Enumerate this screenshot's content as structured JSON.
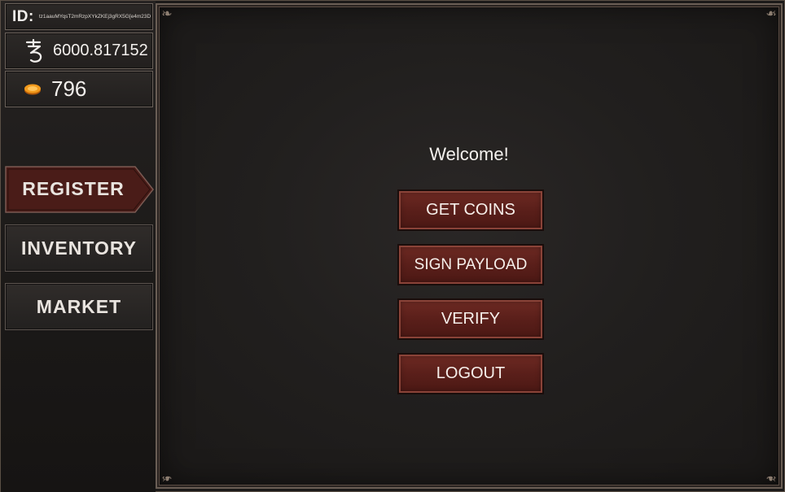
{
  "sidebar": {
    "id_label": "ID:",
    "id_value": "tz1aauMYqsT2mRzpXYkZKEj3gRX5G[e4m23D",
    "balance": "6000.817152",
    "balance_icon": "tezos-icon",
    "coins": "796",
    "coins_icon": "coin-icon",
    "nav": {
      "register": "REGISTER",
      "inventory": "INVENTORY",
      "market": "MARKET"
    }
  },
  "main": {
    "welcome": "Welcome!",
    "buttons": {
      "get_coins": "GET COINS",
      "sign_payload": "SIGN PAYLOAD",
      "verify": "VERIFY",
      "logout": "LOGOUT"
    }
  },
  "colors": {
    "accent_button": "#5a1f1a",
    "register_active": "#4a1c18",
    "panel_border": "#6a5e55",
    "text": "#f2efec"
  }
}
